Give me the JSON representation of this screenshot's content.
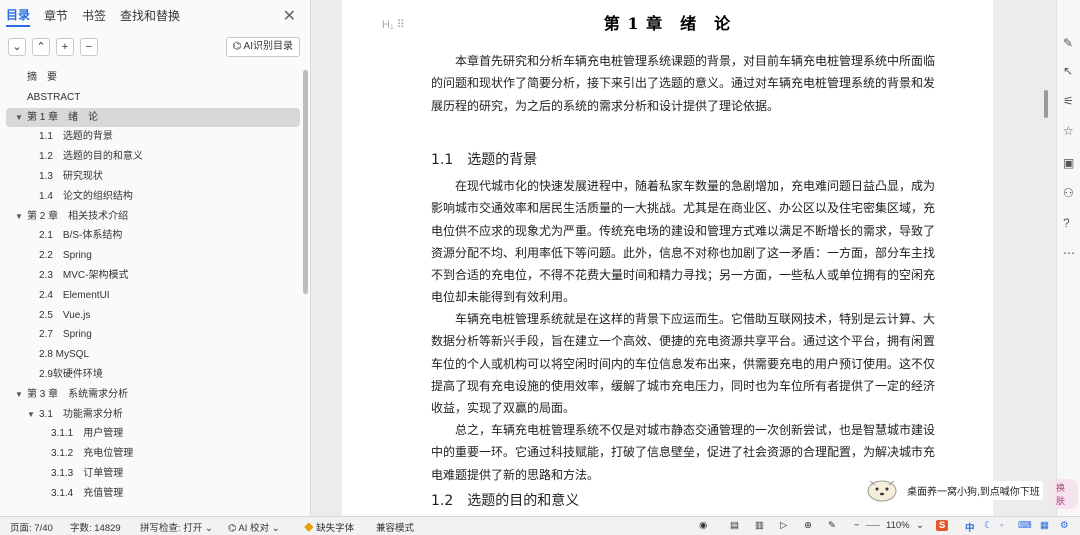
{
  "sidebar": {
    "tabs": [
      "目录",
      "章节",
      "书签",
      "查找和替换"
    ],
    "ai_toc_button": "AI识别目录",
    "toc": [
      {
        "label": "摘　要",
        "level": 0
      },
      {
        "label": "ABSTRACT",
        "level": 0
      },
      {
        "label": "第 1 章　绪　论",
        "level": 0,
        "expanded": true,
        "selected": true
      },
      {
        "label": "1.1　选题的背景",
        "level": 1
      },
      {
        "label": "1.2　选题的目的和意义",
        "level": 1
      },
      {
        "label": "1.3　研究现状",
        "level": 1
      },
      {
        "label": "1.4　论文的组织结构",
        "level": 1
      },
      {
        "label": "第 2 章　相关技术介绍",
        "level": 0,
        "expanded": true
      },
      {
        "label": "2.1　B/S-体系结构",
        "level": 1
      },
      {
        "label": "2.2　Spring",
        "level": 1
      },
      {
        "label": "2.3　MVC-架构模式",
        "level": 1
      },
      {
        "label": "2.4　ElementUI",
        "level": 1
      },
      {
        "label": "2.5　Vue.js",
        "level": 1
      },
      {
        "label": "2.7　Spring",
        "level": 1
      },
      {
        "label": "2.8 MySQL",
        "level": 1
      },
      {
        "label": "2.9软硬件环境",
        "level": 1
      },
      {
        "label": "第 3 章　系统需求分析",
        "level": 0,
        "expanded": true
      },
      {
        "label": "3.1　功能需求分析",
        "level": 1,
        "expanded": true
      },
      {
        "label": "3.1.1　用户管理",
        "level": 2
      },
      {
        "label": "3.1.2　充电位管理",
        "level": 2
      },
      {
        "label": "3.1.3　订单管理",
        "level": 2
      },
      {
        "label": "3.1.4　充值管理",
        "level": 2
      }
    ]
  },
  "document": {
    "chapter_title": "第 1 章　绪　论",
    "intro": "本章首先研究和分析车辆充电桩管理系统课题的背景，对目前车辆充电桩管理系统中所面临的问题和现状作了简要分析，接下来引出了选题的意义。通过对车辆充电桩管理系统的背景和发展历程的研究，为之后的系统的需求分析和设计提供了理论依据。",
    "section1": "1.1　选题的背景",
    "p1": "在现代城市化的快速发展进程中，随着私家车数量的急剧增加，充电难问题日益凸显，成为影响城市交通效率和居民生活质量的一大挑战。尤其是在商业区、办公区以及住宅密集区域，充电位供不应求的现象尤为严重。传统充电场的建设和管理方式难以满足不断增长的需求，导致了资源分配不均、利用率低下等问题。此外，信息不对称也加剧了这一矛盾：一方面，部分车主找不到合适的充电位，不得不花费大量时间和精力寻找；另一方面，一些私人或单位拥有的空闲充电位却未能得到有效利用。",
    "p2": "车辆充电桩管理系统就是在这样的背景下应运而生。它借助互联网技术，特别是云计算、大数据分析等新兴手段，旨在建立一个高效、便捷的充电资源共享平台。通过这个平台，拥有闲置车位的个人或机构可以将空闲时间内的车位信息发布出来，供需要充电的用户预订使用。这不仅提高了现有充电设施的使用效率，缓解了城市充电压力，同时也为车位所有者提供了一定的经济收益，实现了双赢的局面。",
    "p3": "总之，车辆充电桩管理系统不仅是对城市静态交通管理的一次创新尝试，也是智慧城市建设中的重要一环。它通过科技赋能，打破了信息壁垒，促进了社会资源的合理配置，为解决城市充电难题提供了新的思路和方法。",
    "section2": "1.2　选题的目的和意义"
  },
  "statusbar": {
    "page": "页面: 7/40",
    "words": "字数: 14829",
    "spellcheck": "拼写检查: 打开",
    "ai_check": "AI 校对",
    "missing_font": "缺失字体",
    "compat_mode": "兼容模式",
    "zoom": "110%"
  },
  "mascot": {
    "text": "桌面养一窝小狗,到点喊你下班",
    "button": "换肤"
  },
  "taskbar_text": "中"
}
